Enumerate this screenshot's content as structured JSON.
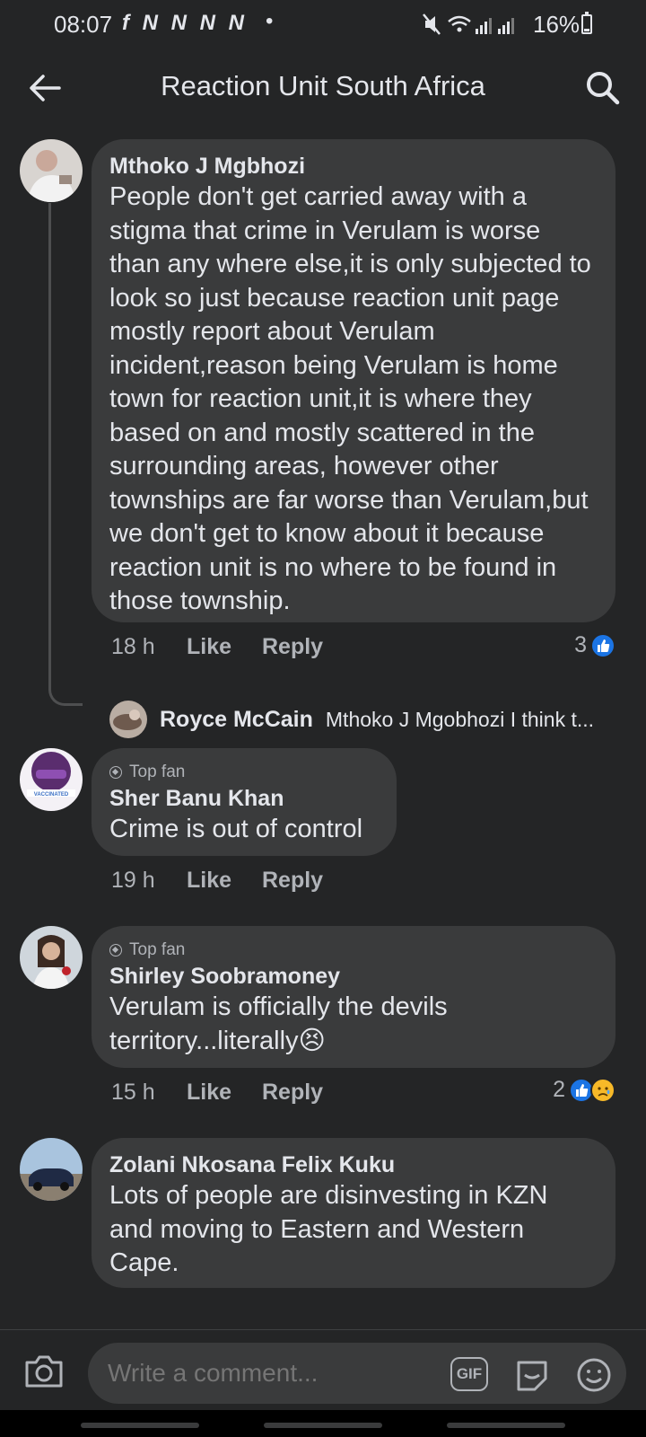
{
  "status_bar": {
    "time": "08:07",
    "app_icons": "f N N N N",
    "battery": "16%"
  },
  "header": {
    "title": "Reaction Unit South Africa",
    "back_icon": "back-arrow-icon",
    "search_icon": "search-icon"
  },
  "comments": [
    {
      "author": "Mthoko J Mgbhozi",
      "text": "People don't get carried away with a stigma that crime in Verulam is worse than any where else,it is only subjected to look so just because reaction unit page mostly report about  Verulam incident,reason being Verulam is home town for reaction unit,it is where they based on and mostly scattered in the surrounding areas, however other townships are far worse than Verulam,but we don't get to know about it because reaction unit is no where to be found in those township.",
      "time": "18 h",
      "like_label": "Like",
      "reply_label": "Reply",
      "reaction_count": "3"
    },
    {
      "badge": "Top fan",
      "author": "Sher Banu Khan",
      "text": "Crime is out of control",
      "time": "19 h",
      "like_label": "Like",
      "reply_label": "Reply"
    },
    {
      "badge": "Top fan",
      "author": "Shirley Soobramoney",
      "text": "Verulam is officially the devils territory...literally",
      "emoji": "😣",
      "time": "15 h",
      "like_label": "Like",
      "reply_label": "Reply",
      "reaction_count": "2"
    },
    {
      "author": "Zolani Nkosana Felix Kuku",
      "text": "Lots of people are disinvesting in KZN and moving to Eastern and Western Cape."
    }
  ],
  "reply_preview": {
    "author": "Royce McCain",
    "text": "Mthoko J Mgobhozi I think t..."
  },
  "composer": {
    "placeholder": "Write a comment...",
    "gif_label": "GIF"
  },
  "colors": {
    "background": "#242526",
    "bubble": "#3a3b3c",
    "text": "#e4e6eb",
    "secondary_text": "#b0b3b8",
    "like_blue": "#1b74e4"
  }
}
